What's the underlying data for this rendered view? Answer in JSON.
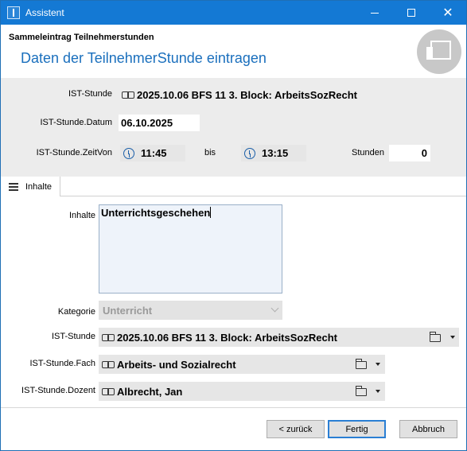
{
  "window": {
    "title": "Assistent"
  },
  "header": {
    "subtitle": "Sammeleintrag Teilnehmerstunden",
    "heading": "Daten der TeilnehmerStunde eintragen"
  },
  "info": {
    "ist_stunde_label": "IST-Stunde",
    "ist_stunde_value": "2025.10.06 BFS 11 3. Block: ArbeitsSozRecht",
    "datum_label": "IST-Stunde.Datum",
    "datum_value": "06.10.2025",
    "zeitvon_label": "IST-Stunde.ZeitVon",
    "zeit_von": "11:45",
    "bis_label": "bis",
    "zeit_bis": "13:15",
    "stunden_label": "Stunden",
    "stunden_value": "0"
  },
  "tab": {
    "label": "Inhalte"
  },
  "form": {
    "inhalte_label": "Inhalte",
    "inhalte_value": "Unterrichtsgeschehen",
    "kategorie_label": "Kategorie",
    "kategorie_value": "Unterricht",
    "ist_stunde_label": "IST-Stunde",
    "ist_stunde_value": "2025.10.06 BFS 11 3. Block: ArbeitsSozRecht",
    "fach_label": "IST-Stunde.Fach",
    "fach_value": "Arbeits- und Sozialrecht",
    "dozent_label": "IST-Stunde.Dozent",
    "dozent_value": "Albrecht, Jan"
  },
  "buttons": {
    "back": "< zurück",
    "finish": "Fertig",
    "cancel": "Abbruch"
  },
  "colors": {
    "titlebar": "#1479d4",
    "heading": "#1a6fbd"
  }
}
